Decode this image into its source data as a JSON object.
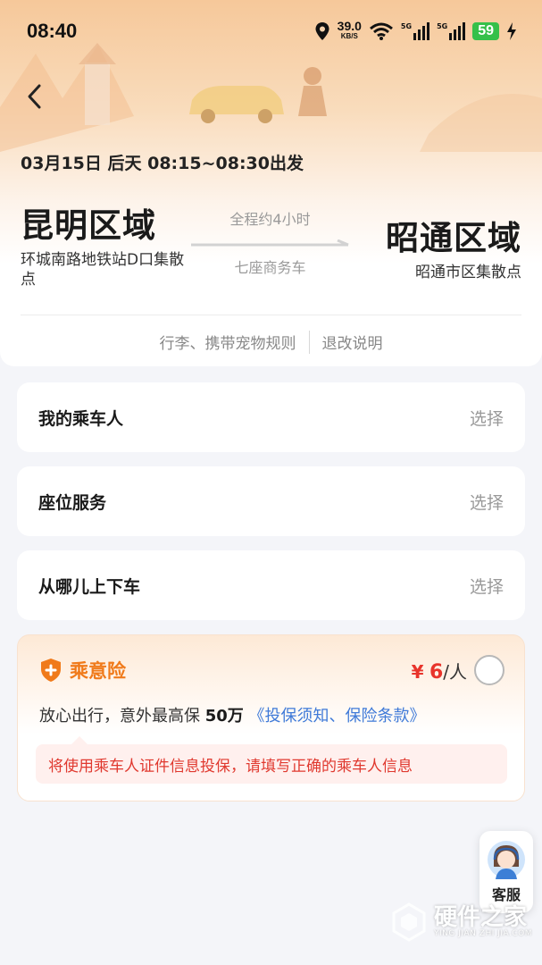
{
  "status_bar": {
    "time": "08:40",
    "net_speed": "39.0",
    "net_unit": "KB/S",
    "signal_1": "5G",
    "signal_2": "5G",
    "battery": "59"
  },
  "trip": {
    "depart_text": "03月15日 后天  08:15~08:30出发",
    "from_city": "昆明区域",
    "from_station": "环城南路地铁站D口集散点",
    "to_city": "昭通区域",
    "to_station": "昭通市区集散点",
    "duration": "全程约4小时",
    "vehicle": "七座商务车"
  },
  "rules": {
    "luggage_link": "行李、携带宠物规则",
    "refund_link": "退改说明"
  },
  "cards": [
    {
      "label": "我的乘车人",
      "action": "选择"
    },
    {
      "label": "座位服务",
      "action": "选择"
    },
    {
      "label": "从哪儿上下车",
      "action": "选择"
    }
  ],
  "insurance": {
    "name": "乘意险",
    "price_symbol": "¥",
    "price": "6",
    "price_unit": "/人",
    "desc_prefix": "放心出行，意外最高保 ",
    "desc_amount": "50万",
    "desc_link": "《投保须知、保险条款》",
    "tip": "将使用乘车人证件信息投保，请填写正确的乘车人信息"
  },
  "customer_service": {
    "label": "客服"
  },
  "watermark": {
    "text": "硬件之家",
    "sub": "YING JIAN ZHI JIA.COM"
  },
  "colors": {
    "accent_orange": "#f07a1a",
    "price_red": "#e8342b",
    "link_blue": "#3f7ad8",
    "battery_green": "#35c04a"
  }
}
